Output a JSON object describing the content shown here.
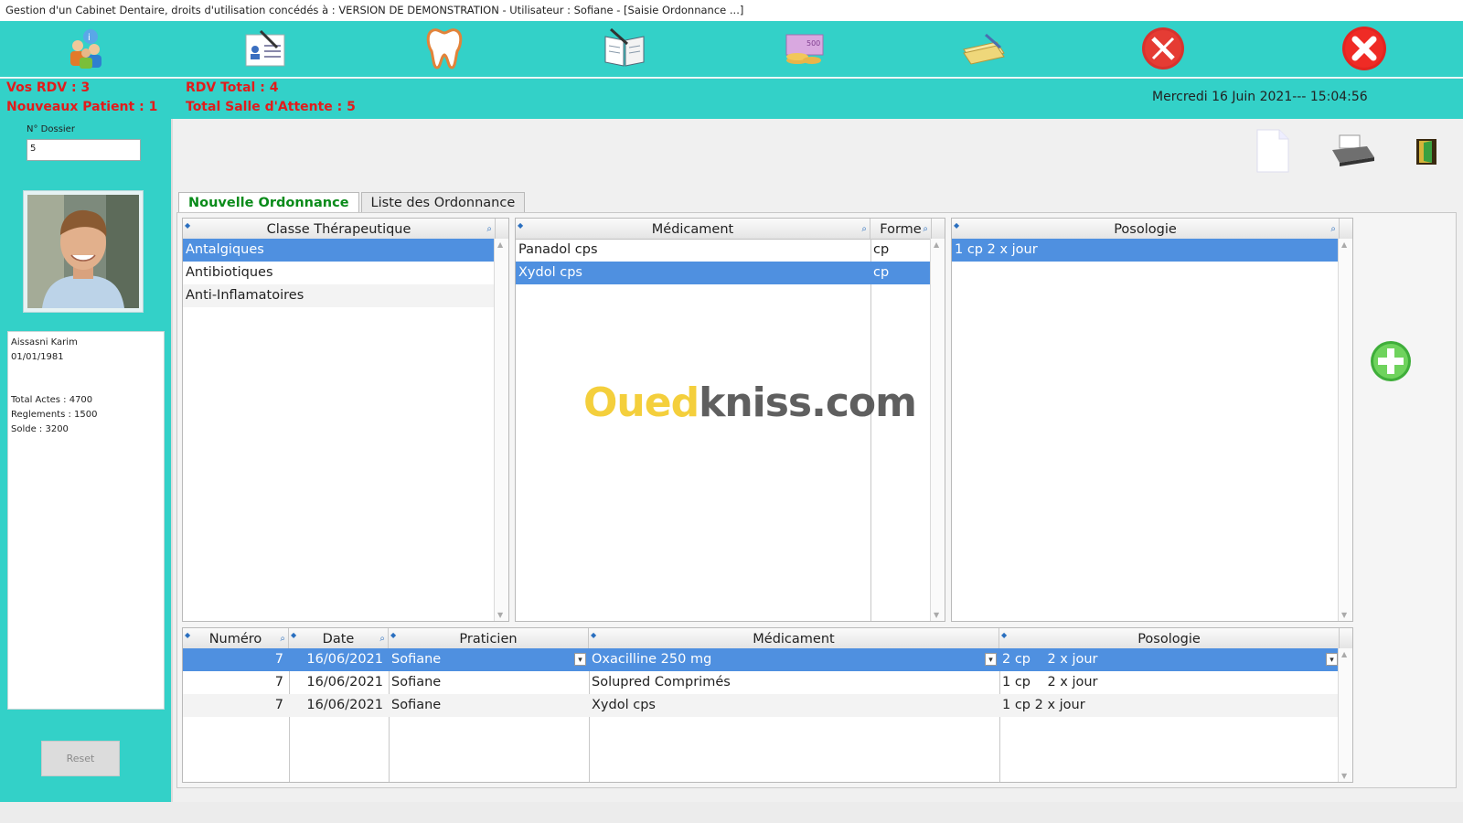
{
  "window": {
    "title": "Gestion d'un Cabinet Dentaire, droits d'utilisation concédés à : VERSION DE DEMONSTRATION - Utilisateur : Sofiane - [Saisie Ordonnance ...]"
  },
  "toolbar": {
    "icons": [
      "patients-icon",
      "dossier-icon",
      "tooth-icon",
      "book-icon",
      "money-icon",
      "payment-icon",
      "tools-icon",
      "close-icon"
    ]
  },
  "info": {
    "vos_rdv": "Vos RDV : 3",
    "nouveaux_patient": "Nouveaux Patient : 1",
    "rdv_total": "RDV Total : 4",
    "salle_attente": "Total Salle d'Attente : 5",
    "datetime": "Mercredi 16 Juin 2021--- 15:04:56"
  },
  "sidebar": {
    "dossier_label": "N° Dossier",
    "dossier_value": "5",
    "patient_name": "Aissasni Karim",
    "patient_dob": "01/01/1981",
    "total_actes": "Total Actes : 4700",
    "reglements": "Reglements : 1500",
    "solde": "Solde : 3200",
    "reset_label": "Reset"
  },
  "tabs": {
    "nouvelle": "Nouvelle Ordonnance",
    "liste": "Liste des Ordonnance"
  },
  "classe_grid": {
    "header": "Classe Thérapeutique",
    "rows": [
      "Antalgiques",
      "Antibiotiques",
      "Anti-Inflamatoires"
    ]
  },
  "medicament_grid": {
    "header_med": "Médicament",
    "header_forme": "Forme",
    "rows": [
      {
        "med": "Panadol cps",
        "forme": "cp"
      },
      {
        "med": "Xydol cps",
        "forme": "cp"
      }
    ]
  },
  "posologie_grid": {
    "header": "Posologie",
    "rows": [
      "1 cp 2 x jour"
    ]
  },
  "ordonnance_grid": {
    "headers": {
      "numero": "Numéro",
      "date": "Date",
      "praticien": "Praticien",
      "medicament": "Médicament",
      "posologie": "Posologie"
    },
    "rows": [
      {
        "numero": "7",
        "date": "16/06/2021",
        "praticien": "Sofiane",
        "medicament": "Oxacilline 250 mg",
        "posologie": "2 cp    2 x jour"
      },
      {
        "numero": "7",
        "date": "16/06/2021",
        "praticien": "Sofiane",
        "medicament": "Solupred Comprimés",
        "posologie": "1 cp    2 x jour"
      },
      {
        "numero": "7",
        "date": "16/06/2021",
        "praticien": "Sofiane",
        "medicament": "Xydol cps",
        "posologie": "1 cp 2 x jour"
      }
    ]
  },
  "watermark": {
    "part1": "Oued",
    "part2": "kniss.com"
  },
  "colors": {
    "teal": "#33d1c8",
    "selection": "#4f90e0",
    "alert_red": "#e31b1b",
    "tab_green": "#0a8b1a"
  }
}
